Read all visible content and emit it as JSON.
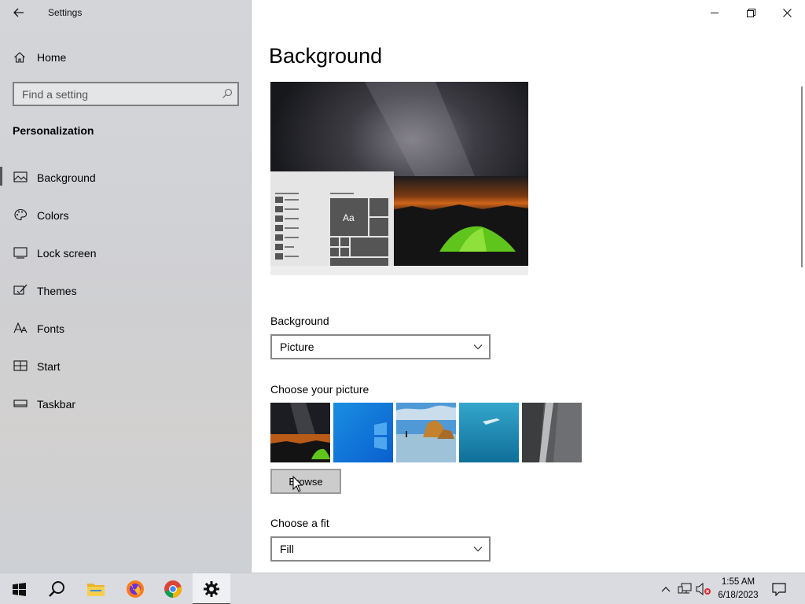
{
  "app": {
    "title": "Settings"
  },
  "sidebar": {
    "home_label": "Home",
    "search_placeholder": "Find a setting",
    "section_title": "Personalization",
    "items": [
      {
        "label": "Background",
        "icon": "picture-icon",
        "selected": true
      },
      {
        "label": "Colors",
        "icon": "palette-icon"
      },
      {
        "label": "Lock screen",
        "icon": "lock-screen-icon"
      },
      {
        "label": "Themes",
        "icon": "brush-icon"
      },
      {
        "label": "Fonts",
        "icon": "fonts-icon"
      },
      {
        "label": "Start",
        "icon": "start-icon"
      },
      {
        "label": "Taskbar",
        "icon": "taskbar-icon"
      }
    ]
  },
  "main": {
    "page_title": "Background",
    "preview": {
      "sample_text": "Aa"
    },
    "background_label": "Background",
    "background_value": "Picture",
    "choose_picture_label": "Choose your picture",
    "pictures": [
      "night-sky-tent",
      "windows-blue",
      "beach-rocks",
      "underwater-swimmer",
      "rock-cliff"
    ],
    "browse_label": "Browse",
    "fit_label": "Choose a fit",
    "fit_value": "Fill"
  },
  "taskbar": {
    "apps": [
      "start-button",
      "search-button",
      "file-explorer",
      "firefox",
      "chrome",
      "settings"
    ],
    "time": "1:55 AM",
    "date": "6/18/2023"
  },
  "colors": {
    "accent": "#4cc21a",
    "sidebar_bg": "#d2d3d7",
    "taskbar_bg": "#d9dbe0"
  }
}
